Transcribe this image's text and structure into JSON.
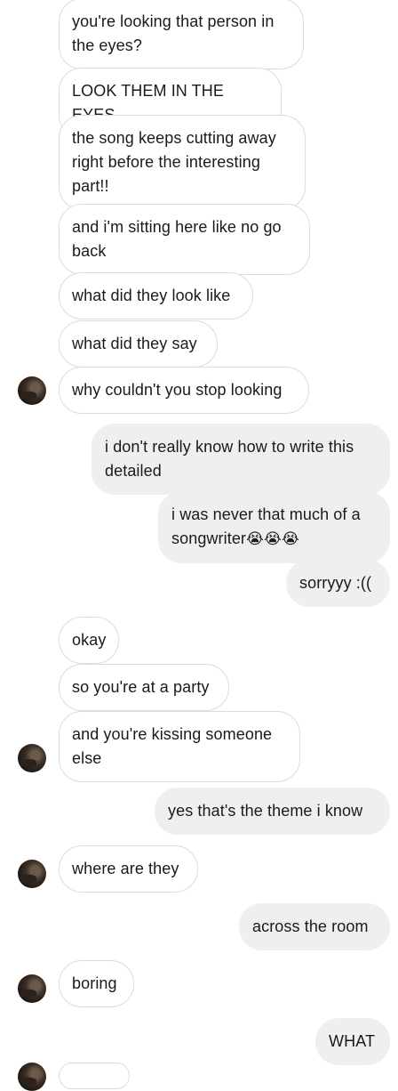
{
  "messages": [
    {
      "side": "in",
      "text": "you're looking that person in the eyes?"
    },
    {
      "side": "in",
      "text": "LOOK THEM IN THE EYES"
    },
    {
      "side": "in",
      "text": "the song keeps cutting away right before the interesting part!!"
    },
    {
      "side": "in",
      "text": "and i'm sitting here like no go back"
    },
    {
      "side": "in",
      "text": "what did they look like"
    },
    {
      "side": "in",
      "text": "what did they say"
    },
    {
      "side": "in",
      "text": "why couldn't you stop looking"
    },
    {
      "side": "out",
      "text": "i don't really know how to write this detailed"
    },
    {
      "side": "out",
      "text": "i was never that much of a songwriter",
      "emoji": "😭😭😭"
    },
    {
      "side": "out",
      "text": "sorryyy :(("
    },
    {
      "side": "in",
      "text": "okay"
    },
    {
      "side": "in",
      "text": "so you're at a party"
    },
    {
      "side": "in",
      "text": "and you're kissing someone else"
    },
    {
      "side": "out",
      "text": "yes that's the theme i know"
    },
    {
      "side": "in",
      "text": "where are they"
    },
    {
      "side": "out",
      "text": "across the room"
    },
    {
      "side": "in",
      "text": "boring"
    },
    {
      "side": "out",
      "text": "WHAT"
    }
  ],
  "colors": {
    "incoming_bubble": "#ffffff",
    "incoming_border": "#dcdcdc",
    "outgoing_bubble": "#efefef",
    "text": "#1a1a1a"
  },
  "icons": {
    "avatar": "contact-avatar-icon"
  }
}
